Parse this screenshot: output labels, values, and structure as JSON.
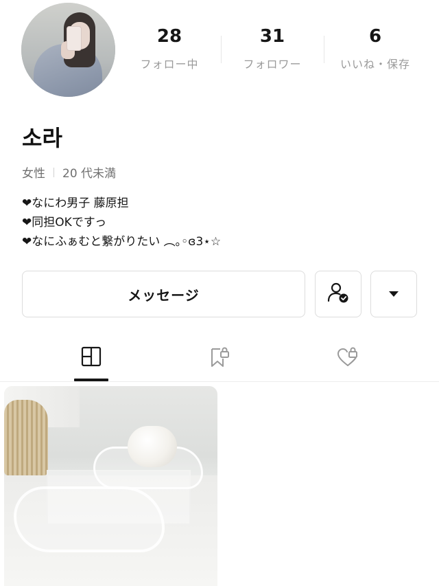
{
  "profile": {
    "username": "소라",
    "gender": "女性",
    "age": "20 代未満",
    "bio": [
      "❤なにわ男子 藤原担",
      "❤同担OKですっ",
      "❤なにふぁむと繋がりたい ︵｡◦ɞ3⋆☆"
    ]
  },
  "stats": [
    {
      "count": "28",
      "label": "フォロー中"
    },
    {
      "count": "31",
      "label": "フォロワー"
    },
    {
      "count": "6",
      "label": "いいね・保存"
    }
  ],
  "actions": {
    "message_label": "メッセージ",
    "follow_icon": "person-check-icon",
    "more_icon": "caret-down-icon"
  },
  "tabs": [
    {
      "icon": "grid-icon",
      "active": true
    },
    {
      "icon": "bookmark-lock-icon",
      "active": false
    },
    {
      "icon": "heart-lock-icon",
      "active": false
    }
  ],
  "colors": {
    "text": "#161616",
    "muted": "#9a9a9a",
    "border": "#dcdcdc"
  }
}
